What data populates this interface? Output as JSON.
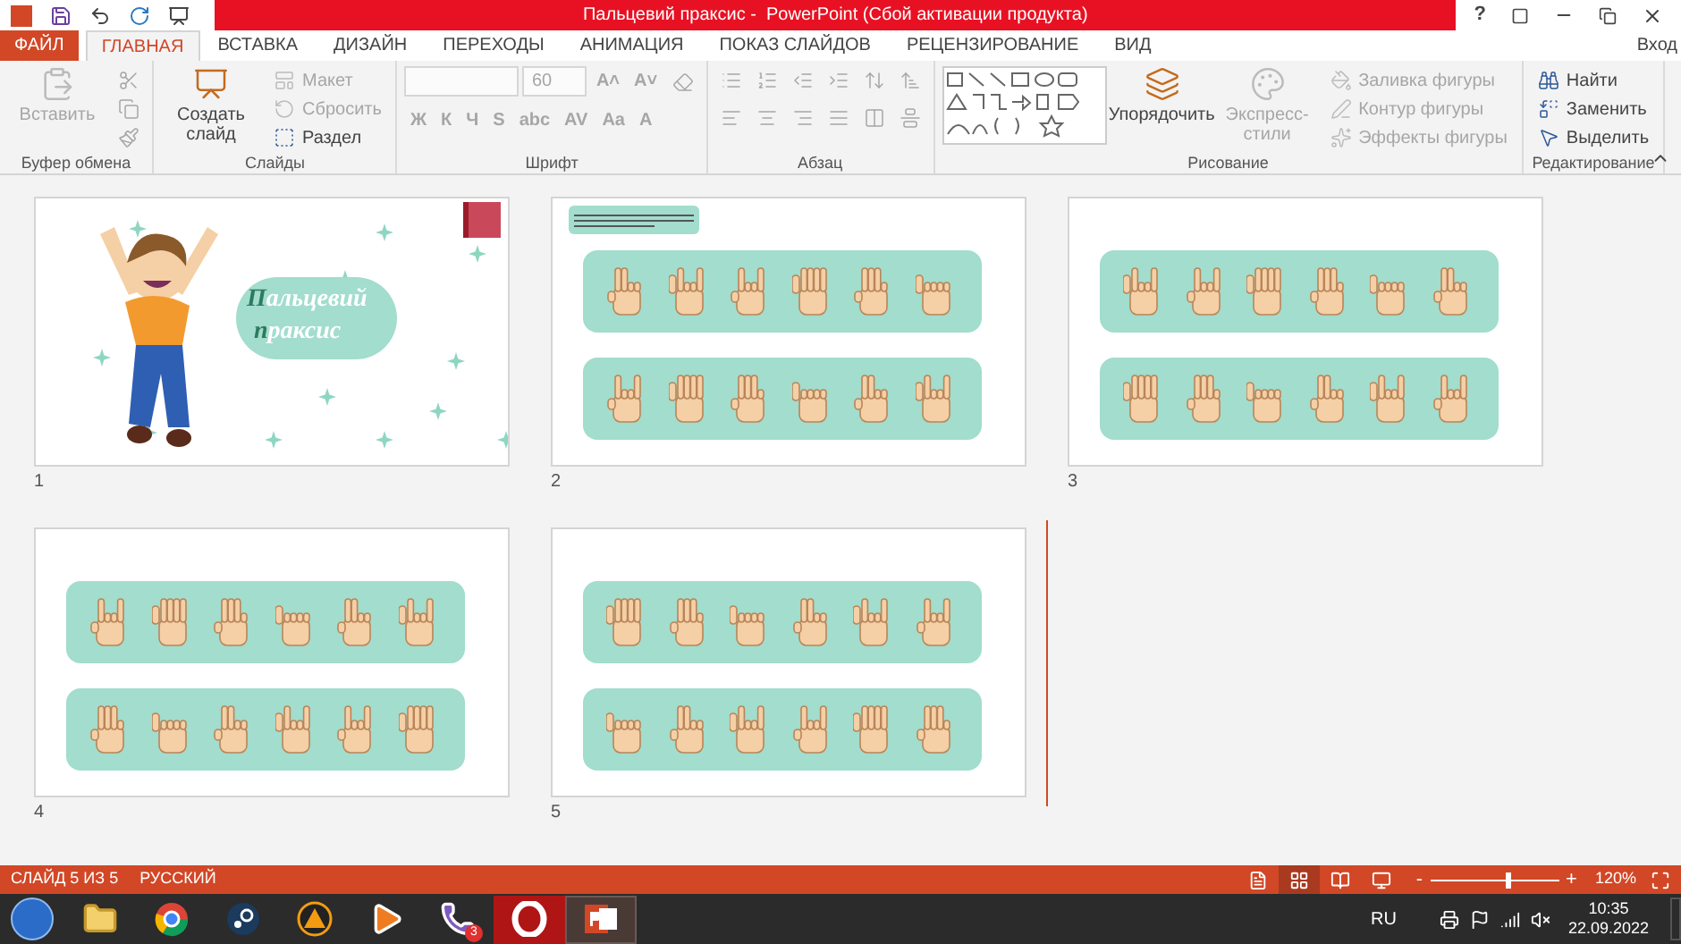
{
  "title_bar": {
    "title": "Пальцевий праксис -  PowerPoint (Сбой активации продукта)",
    "help": "?"
  },
  "tabs": [
    {
      "label": "ФАЙЛ",
      "kind": "file",
      "selected": false
    },
    {
      "label": "ГЛАВНАЯ",
      "kind": "tab",
      "selected": true
    },
    {
      "label": "ВСТАВКА",
      "kind": "tab",
      "selected": false
    },
    {
      "label": "ДИЗАЙН",
      "kind": "tab",
      "selected": false
    },
    {
      "label": "ПЕРЕХОДЫ",
      "kind": "tab",
      "selected": false
    },
    {
      "label": "АНИМАЦИЯ",
      "kind": "tab",
      "selected": false
    },
    {
      "label": "ПОКАЗ СЛАЙДОВ",
      "kind": "tab",
      "selected": false
    },
    {
      "label": "РЕЦЕНЗИРОВАНИЕ",
      "kind": "tab",
      "selected": false
    },
    {
      "label": "ВИД",
      "kind": "tab",
      "selected": false
    }
  ],
  "sign_in": "Вход",
  "ribbon": [
    {
      "label": "Буфер обмена",
      "kind": "clipboard",
      "items": [
        {
          "kind": "large",
          "label": "Вставить",
          "disabled": true
        },
        {
          "kind": "icon",
          "disabled": true
        },
        {
          "kind": "icon",
          "disabled": true
        },
        {
          "kind": "icon",
          "disabled": true
        }
      ]
    },
    {
      "label": "Слайды",
      "kind": "slides",
      "items": [
        {
          "kind": "large",
          "label": "Создать слайд",
          "disabled": false
        },
        {
          "kind": "small",
          "label": "Макет",
          "disabled": true
        },
        {
          "kind": "small",
          "label": "Сбросить",
          "disabled": true
        },
        {
          "kind": "small",
          "label": "Раздел",
          "disabled": false
        }
      ]
    },
    {
      "label": "Шрифт",
      "kind": "font",
      "items": [
        {
          "kind": "field",
          "disabled": true
        },
        {
          "kind": "field",
          "value": "60",
          "disabled": true
        },
        {
          "kind": "glyph",
          "label": "A˄",
          "disabled": true
        },
        {
          "kind": "glyph",
          "label": "A˅",
          "disabled": true
        },
        {
          "kind": "icon",
          "disabled": true
        },
        {
          "kind": "glyph",
          "label": "Ж",
          "disabled": true
        },
        {
          "kind": "glyph",
          "label": "К",
          "disabled": true
        },
        {
          "kind": "glyph",
          "label": "Ч",
          "disabled": true
        },
        {
          "kind": "glyph",
          "label": "S",
          "disabled": true
        },
        {
          "kind": "glyph",
          "label": "abc",
          "disabled": true
        },
        {
          "kind": "glyph",
          "label": "AV",
          "disabled": true
        },
        {
          "kind": "glyph",
          "label": "Aa",
          "disabled": true
        },
        {
          "kind": "glyph",
          "label": "A",
          "disabled": true
        }
      ]
    },
    {
      "label": "Абзац",
      "kind": "paragraph",
      "items": [
        {
          "kind": "icon",
          "disabled": true
        },
        {
          "kind": "icon",
          "disabled": true
        },
        {
          "kind": "icon",
          "disabled": true
        },
        {
          "kind": "icon",
          "disabled": true
        },
        {
          "kind": "icon",
          "disabled": true
        },
        {
          "kind": "icon",
          "disabled": true
        },
        {
          "kind": "icon",
          "disabled": true
        },
        {
          "kind": "icon",
          "disabled": true
        },
        {
          "kind": "icon",
          "disabled": true
        },
        {
          "kind": "icon",
          "disabled": true
        },
        {
          "kind": "icon",
          "disabled": true
        },
        {
          "kind": "icon",
          "disabled": true
        }
      ]
    },
    {
      "label": "Рисование",
      "kind": "drawing",
      "items": [
        {
          "kind": "gallery"
        },
        {
          "kind": "large",
          "label": "Упорядочить",
          "disabled": false
        },
        {
          "kind": "large",
          "label": "Экспресс-стили",
          "disabled": true
        },
        {
          "kind": "small",
          "label": "Заливка фигуры",
          "disabled": true
        },
        {
          "kind": "small",
          "label": "Контур фигуры",
          "disabled": true
        },
        {
          "kind": "small",
          "label": "Эффекты фигуры",
          "disabled": true
        }
      ]
    },
    {
      "label": "Редактирование",
      "kind": "editing",
      "items": [
        {
          "kind": "small",
          "label": "Найти",
          "disabled": false
        },
        {
          "kind": "small",
          "label": "Заменить",
          "disabled": false
        },
        {
          "kind": "small",
          "label": "Выделить",
          "disabled": false
        }
      ]
    }
  ],
  "slides": [
    {
      "number": "1",
      "kind": "title",
      "title_lines": [
        {
          "initial": "П",
          "rest": "альцевий"
        },
        {
          "initial": "п",
          "rest": "раксис"
        }
      ]
    },
    {
      "number": "2",
      "kind": "hands",
      "note": true
    },
    {
      "number": "3",
      "kind": "hands"
    },
    {
      "number": "4",
      "kind": "hands"
    },
    {
      "number": "5",
      "kind": "hands"
    }
  ],
  "status_bar": {
    "slide": "СЛАЙД 5 ИЗ 5",
    "language": "РУССКИЙ",
    "views": [
      {
        "kind": "normal",
        "selected": false
      },
      {
        "kind": "sorter",
        "selected": true
      },
      {
        "kind": "reading",
        "selected": false
      },
      {
        "kind": "show",
        "selected": false
      }
    ],
    "zoom_minus": "-",
    "zoom_plus": "+",
    "zoom": {
      "level": 0.6
    },
    "zoom_value": "120%"
  },
  "taskbar": {
    "apps": [
      {
        "kind": "explorer",
        "selected": false
      },
      {
        "kind": "chrome",
        "selected": false
      },
      {
        "kind": "steam",
        "selected": false
      },
      {
        "kind": "aimp",
        "selected": false
      },
      {
        "kind": "player",
        "selected": false
      },
      {
        "kind": "viber",
        "badge": "3",
        "selected": false
      },
      {
        "kind": "opera",
        "selected": false
      },
      {
        "kind": "powerpoint",
        "selected": true
      }
    ],
    "language": "RU",
    "time": "10:35",
    "date": "22.09.2022"
  }
}
